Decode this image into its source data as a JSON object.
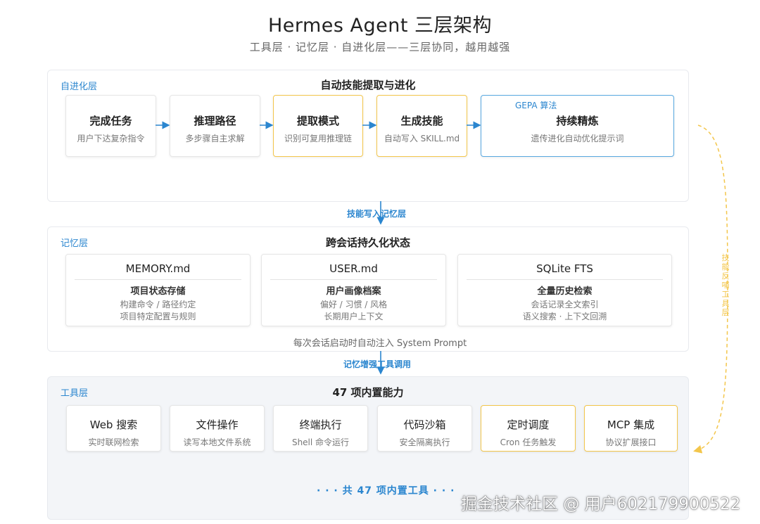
{
  "header": {
    "title": "Hermes Agent 三层架构",
    "subtitle": "工具层 · 记忆层 · 自进化层——三层协同，越用越强"
  },
  "evolution_layer": {
    "label": "自进化层",
    "title": "自动技能提取与进化",
    "steps": [
      {
        "title": "完成任务",
        "desc": "用户下达复杂指令"
      },
      {
        "title": "推理路径",
        "desc": "多步骤自主求解"
      },
      {
        "title": "提取模式",
        "desc": "识别可复用推理链"
      },
      {
        "title": "生成技能",
        "desc": "自动写入 SKILL.md"
      },
      {
        "title": "持续精炼",
        "desc": "遗传进化自动优化提示词",
        "tag": "GEPA 算法"
      }
    ]
  },
  "connector_1": "技能写入记忆层",
  "memory_layer": {
    "label": "记忆层",
    "title": "跨会话持久化状态",
    "files": [
      {
        "name": "MEMORY.md",
        "desc": "项目状态存储",
        "lines": [
          "构建命令 / 路径约定",
          "项目特定配置与规则"
        ]
      },
      {
        "name": "USER.md",
        "desc": "用户画像档案",
        "lines": [
          "偏好 / 习惯 / 风格",
          "长期用户上下文"
        ]
      },
      {
        "name": "SQLite FTS",
        "desc": "全量历史检索",
        "lines": [
          "会话记录全文索引",
          "语义搜索 · 上下文回溯"
        ]
      }
    ],
    "note": "每次会话启动时自动注入 System Prompt"
  },
  "connector_2": "记忆增强工具调用",
  "tool_layer": {
    "label": "工具层",
    "title": "47 项内置能力",
    "tools": [
      {
        "title": "Web 搜索",
        "desc": "实时联网检索"
      },
      {
        "title": "文件操作",
        "desc": "读写本地文件系统"
      },
      {
        "title": "终端执行",
        "desc": "Shell 命令运行"
      },
      {
        "title": "代码沙箱",
        "desc": "安全隔离执行"
      },
      {
        "title": "定时调度",
        "desc": "Cron 任务触发"
      },
      {
        "title": "MCP 集成",
        "desc": "协议扩展接口"
      }
    ],
    "footer": "· · · 共 47 项内置工具 · · ·"
  },
  "side_feedback_label": "技能反哺工具层",
  "watermark": "掘金技术社区 @ 用户602179900522",
  "colors": {
    "accent_blue": "#2b86cf",
    "highlight_yellow": "#f3c64b",
    "gepa_border": "#58a8e0"
  }
}
